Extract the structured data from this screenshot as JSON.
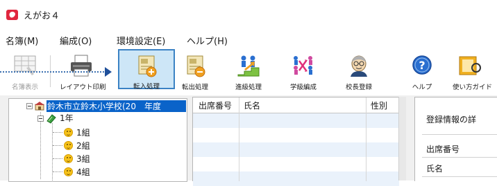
{
  "window": {
    "title": "えがお４"
  },
  "menu": {
    "items": [
      "名簿(M)",
      "編成(O)",
      "環境設定(E)",
      "ヘルプ(H)"
    ]
  },
  "toolbar": {
    "buttons": [
      {
        "label": "名簿表示",
        "icon": "grid-list-icon",
        "state": "disabled"
      },
      {
        "label": "レイアウト印刷",
        "icon": "printer-icon",
        "state": "normal"
      },
      {
        "label": "転入処理",
        "icon": "transfer-in-icon",
        "state": "active"
      },
      {
        "label": "転出処理",
        "icon": "transfer-out-icon",
        "state": "normal"
      },
      {
        "label": "進級処理",
        "icon": "promotion-icon",
        "state": "normal"
      },
      {
        "label": "学級編成",
        "icon": "class-formation-icon",
        "state": "normal"
      },
      {
        "label": "校長登録",
        "icon": "principal-icon",
        "state": "normal"
      },
      {
        "label": "ヘルプ",
        "icon": "help-icon",
        "state": "normal"
      },
      {
        "label": "使い方ガイド",
        "icon": "guide-icon",
        "state": "normal"
      }
    ]
  },
  "tree": {
    "root": "鈴木市立鈴木小学校(20　年度",
    "grade": "1年",
    "classes": [
      "1組",
      "2組",
      "3組",
      "4組"
    ]
  },
  "grid": {
    "columns": [
      "出席番号",
      "氏名",
      "性別"
    ]
  },
  "detail": {
    "title": "登録情報の詳",
    "fields": [
      "出席番号",
      "氏名"
    ]
  },
  "colors": {
    "selection": "#0a63c9",
    "active_tool_bg": "#cde6f7",
    "active_tool_border": "#3b82c4",
    "row_alt": "#eaf2fb",
    "arrow": "#1f4f9a"
  }
}
